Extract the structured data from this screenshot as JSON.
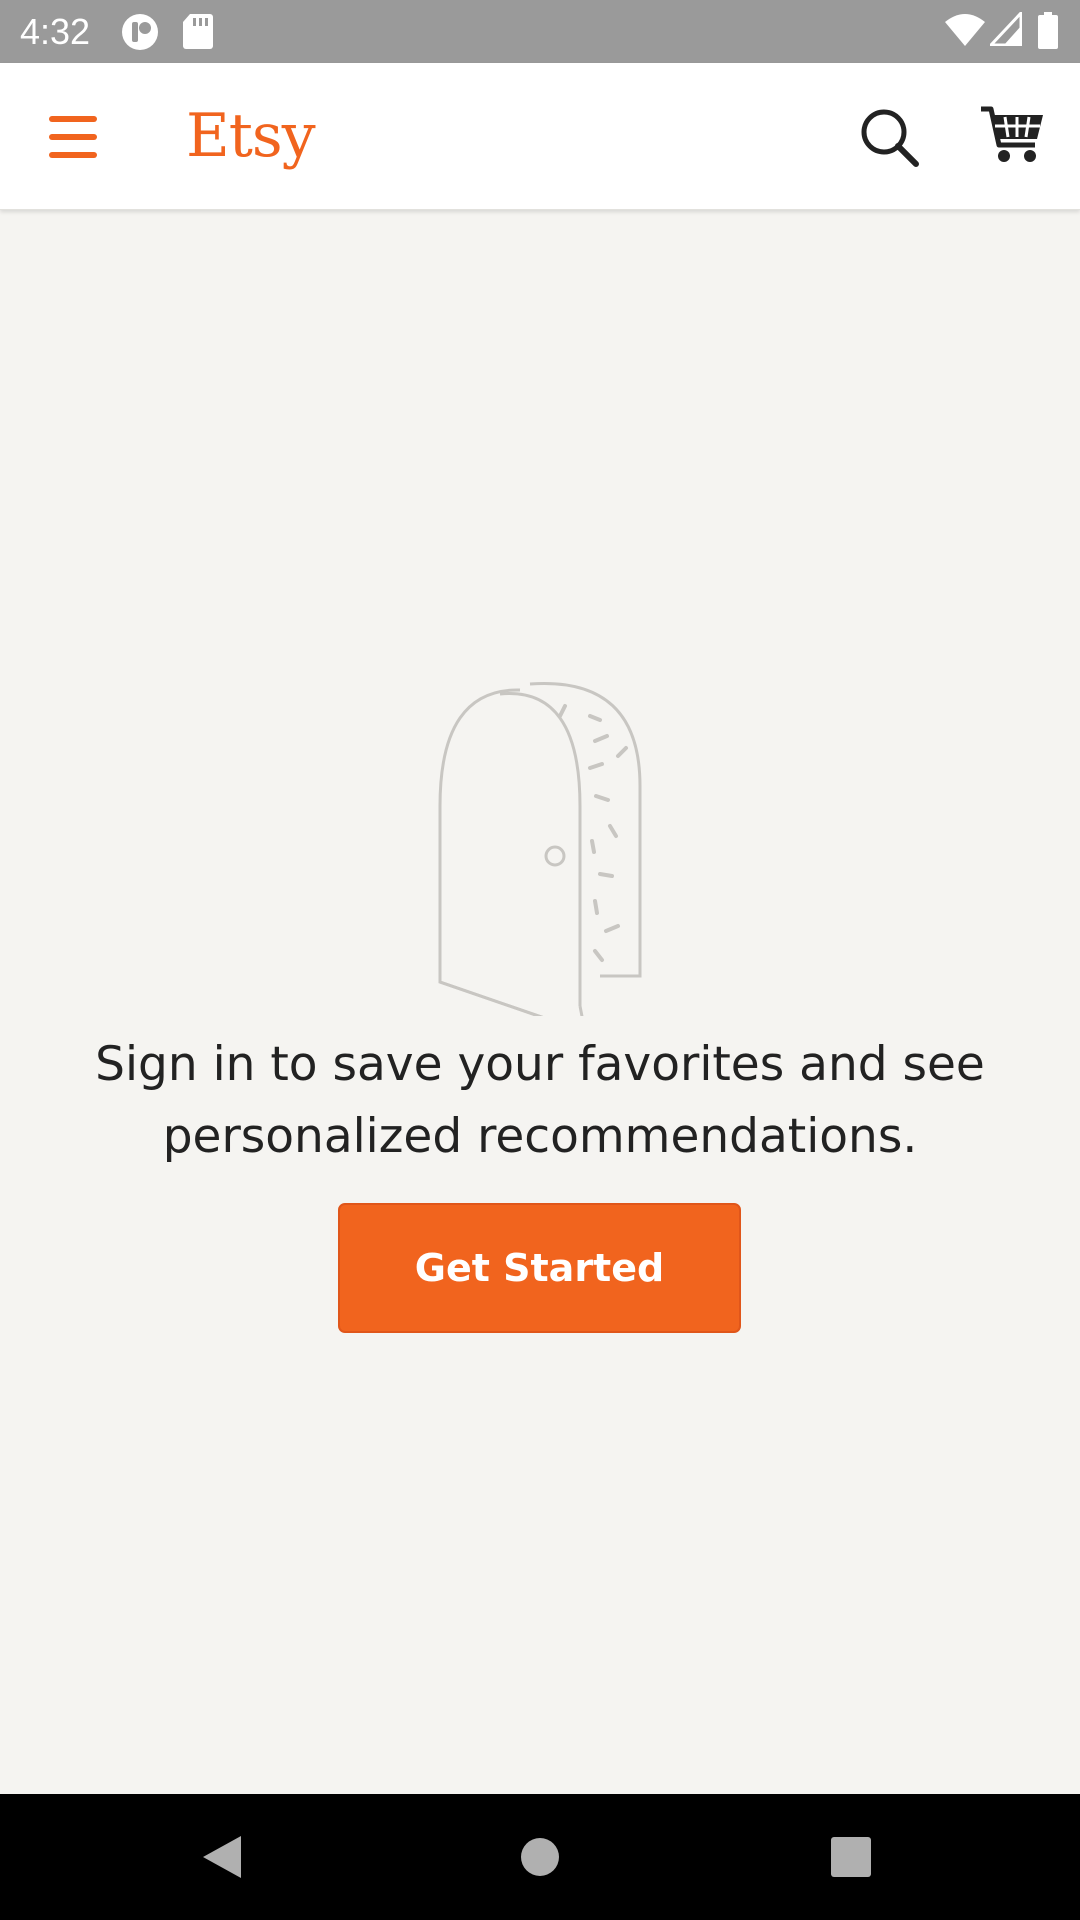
{
  "status_bar": {
    "time": "4:32",
    "icons": [
      "notification-app-icon",
      "sd-card-icon",
      "wifi-icon",
      "cell-signal-icon",
      "battery-icon"
    ]
  },
  "app_bar": {
    "logo": "Etsy",
    "brand_color": "#f1641e",
    "icons": [
      "menu-icon",
      "search-icon",
      "cart-icon"
    ]
  },
  "main": {
    "illustration": "open-door-icon",
    "message_line1": "Sign in to save your favorites and see",
    "message_line2": "personalized recommendations.",
    "cta_label": "Get Started"
  },
  "nav_bar": {
    "icons": [
      "back-icon",
      "home-icon",
      "recents-icon"
    ]
  }
}
